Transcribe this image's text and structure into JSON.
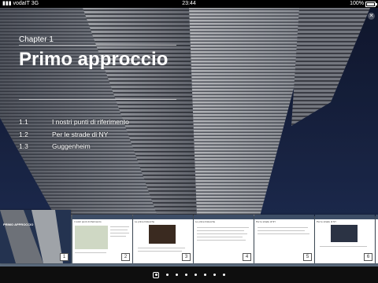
{
  "status": {
    "carrier": "vodaIT",
    "network": "3G",
    "time": "23:44",
    "battery": "100%"
  },
  "page": {
    "chapter_label": "Chapter 1",
    "chapter_title": "Primo approccio",
    "toc": [
      {
        "num": "1.1",
        "title": "I nostri punti di riferimento"
      },
      {
        "num": "1.2",
        "title": "Per le strade di NY"
      },
      {
        "num": "1.3",
        "title": "Guggenheim"
      }
    ]
  },
  "thumbnails": [
    {
      "title": "PRIMO APPROCCIO",
      "page": "1"
    },
    {
      "title": "I nostri punti di riferimento",
      "page": "2"
    },
    {
      "title": "Le prime bistecche",
      "page": "3"
    },
    {
      "title": "Le prime bistecche",
      "page": "4"
    },
    {
      "title": "Per le strade di NY",
      "page": "5"
    },
    {
      "title": "Per le strade di NY",
      "page": "6"
    }
  ],
  "pager": {
    "count": 8,
    "current": 1
  },
  "colors": {
    "sky": "#1a2747",
    "building": "#8c8f94",
    "strip": "#5b6a7c"
  }
}
